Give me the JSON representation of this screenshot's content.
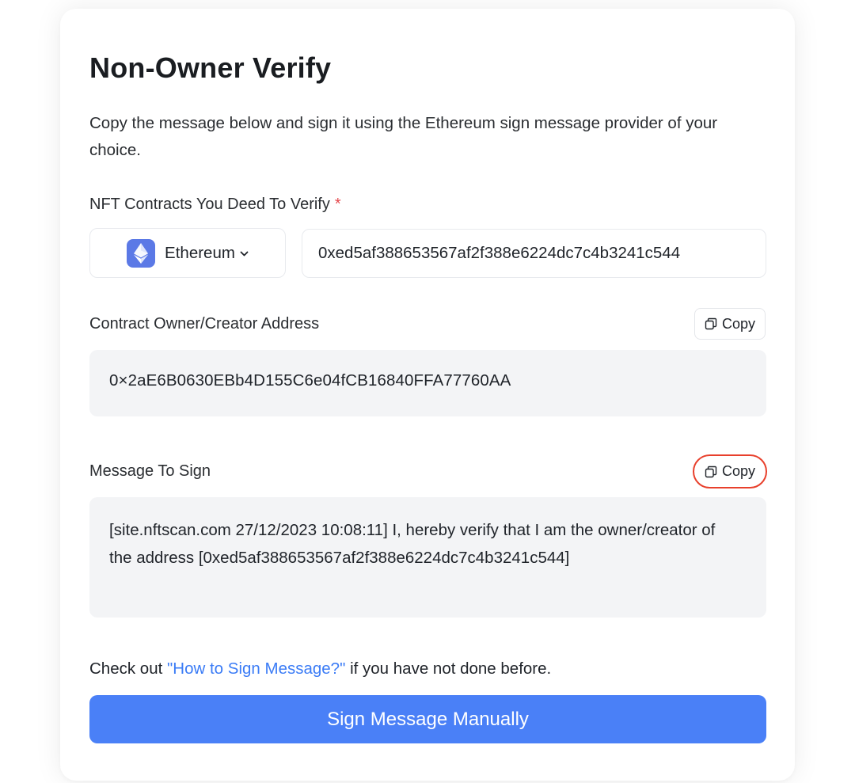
{
  "title": "Non-Owner Verify",
  "description": "Copy the message below and sign it using the Ethereum sign message provider of your choice.",
  "contracts": {
    "label": "NFT Contracts You Deed To Verify",
    "required_mark": "*",
    "chain": {
      "name": "Ethereum",
      "icon": "ethereum-icon"
    },
    "contract_address": "0xed5af388653567af2f388e6224dc7c4b3241c544"
  },
  "owner": {
    "label": "Contract Owner/Creator Address",
    "copy_label": "Copy",
    "address": "0×2aE6B0630EBb4D155C6e04fCB16840FFA77760AA"
  },
  "message": {
    "label": "Message To Sign",
    "copy_label": "Copy",
    "text": "[site.nftscan.com 27/12/2023 10:08:11] I, hereby verify that I am the owner/creator of the address [0xed5af388653567af2f388e6224dc7c4b3241c544]"
  },
  "help": {
    "prefix": "Check out ",
    "link_text": "\"How to Sign Message?\"",
    "suffix": " if you have not done before."
  },
  "sign_button_label": "Sign Message Manually",
  "colors": {
    "accent": "#4a80f7",
    "link": "#3b7cf6",
    "required": "#e5484d",
    "highlight_ring": "#e8402c",
    "eth_badge": "#5b79e6"
  }
}
